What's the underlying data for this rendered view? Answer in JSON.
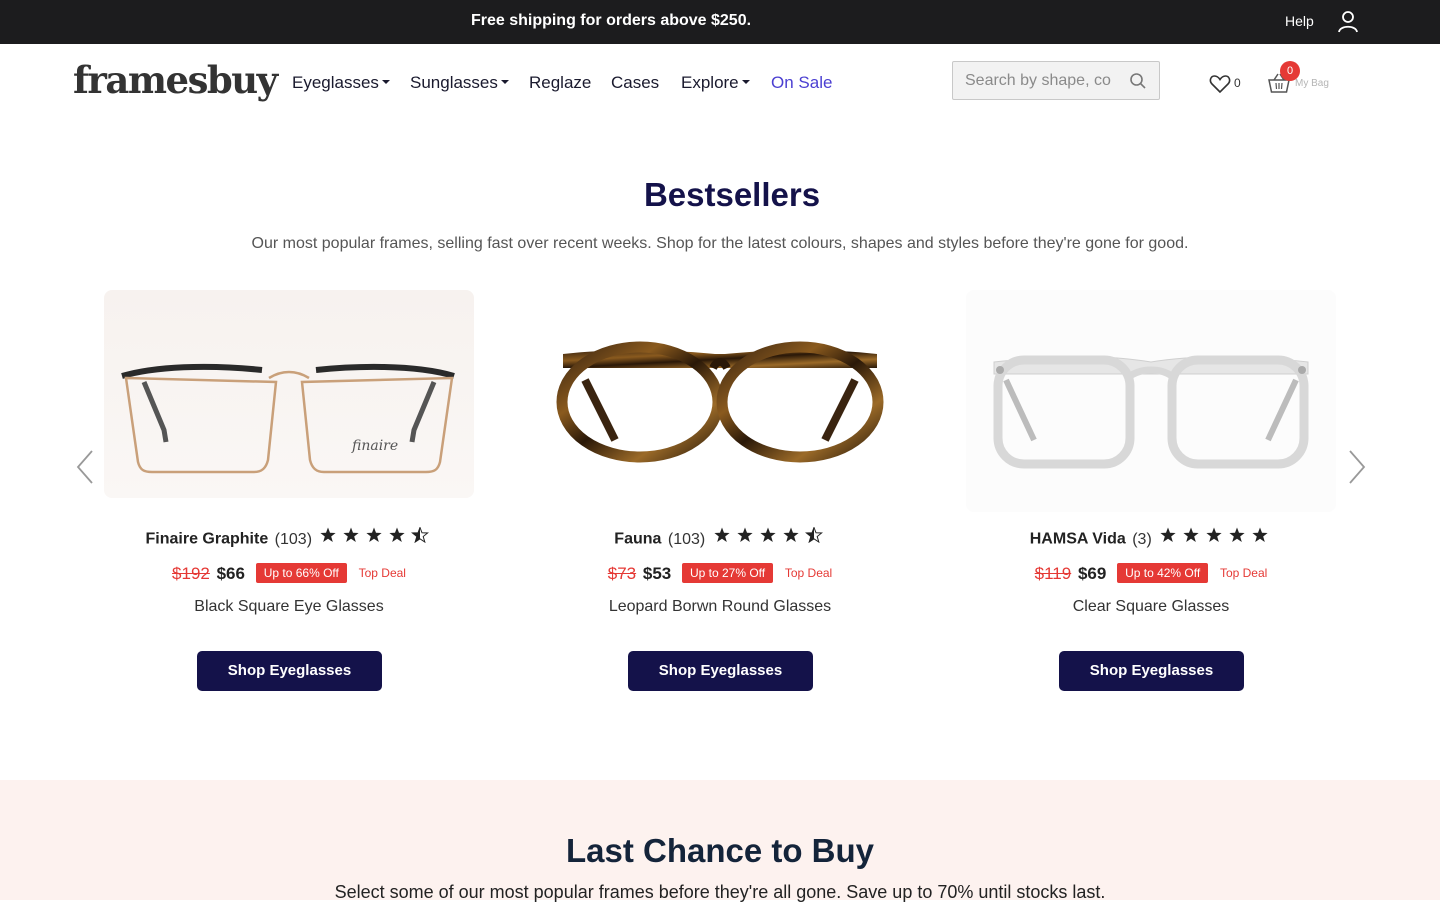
{
  "topbar": {
    "promo": "Free shipping for orders above $250.",
    "help": "Help",
    "user_icon": "user-icon"
  },
  "header": {
    "logo": "framesbuy",
    "nav": [
      {
        "label": "Eyeglasses",
        "has_dropdown": true
      },
      {
        "label": "Sunglasses",
        "has_dropdown": true
      },
      {
        "label": "Reglaze",
        "has_dropdown": false
      },
      {
        "label": "Cases",
        "has_dropdown": false
      },
      {
        "label": "Explore",
        "has_dropdown": true
      },
      {
        "label": "On Sale",
        "has_dropdown": false,
        "color": "#4b3fd1"
      }
    ],
    "search": {
      "placeholder": "Search by shape, co",
      "value": "",
      "icon": "search-icon"
    },
    "wishlist": {
      "count": "0",
      "icon": "heart-icon"
    },
    "bag": {
      "count": "0",
      "label": "My Bag",
      "icon": "basket-icon"
    }
  },
  "bestsellers": {
    "title": "Bestsellers",
    "subtitle": "Our most popular frames, selling fast over recent weeks. Shop for the latest colours, shapes and styles before they're gone for good.",
    "products": [
      {
        "name": "Finaire Graphite",
        "reviews": "(103)",
        "rating": 4.5,
        "old_price": "$192",
        "new_price": "$66",
        "discount": "Up to 66% Off",
        "deal": "Top Deal",
        "description": "Black Square Eye Glasses",
        "button": "Shop Eyeglasses",
        "image_brand_mark": "finaire"
      },
      {
        "name": "Fauna",
        "reviews": "(103)",
        "rating": 4.5,
        "old_price": "$73",
        "new_price": "$53",
        "discount": "Up to 27% Off",
        "deal": "Top Deal",
        "description": "Leopard Borwn Round Glasses",
        "button": "Shop Eyeglasses"
      },
      {
        "name": "HAMSA Vida",
        "reviews": "(3)",
        "rating": 5,
        "old_price": "$119",
        "new_price": "$69",
        "discount": "Up to 42% Off",
        "deal": "Top Deal",
        "description": "Clear Square Glasses",
        "button": "Shop Eyeglasses"
      }
    ],
    "colors": {
      "accent": "#14124a",
      "sale_red": "#e53935"
    }
  },
  "last_chance": {
    "title": "Last Chance to Buy",
    "subtitle": "Select some of our most popular frames before they're all gone. Save up to 70% until stocks last.",
    "background": "#fdf2ef"
  }
}
